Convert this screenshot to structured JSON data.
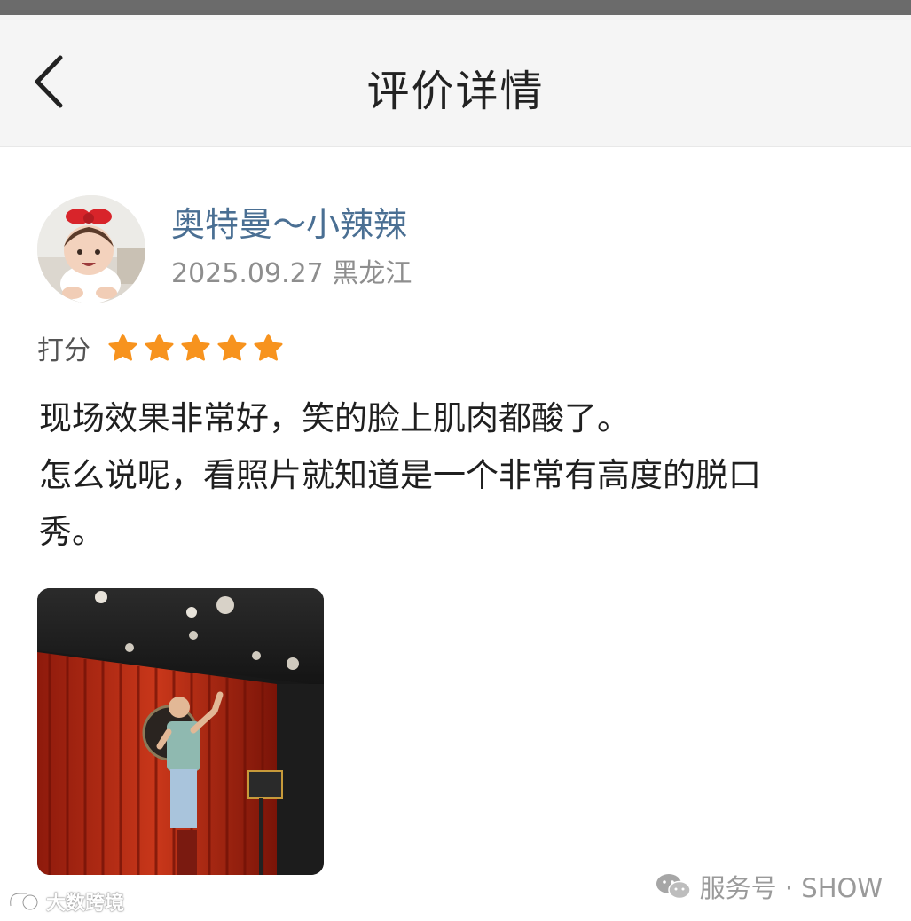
{
  "nav": {
    "title": "评价详情",
    "back_icon": "chevron-left-icon"
  },
  "review": {
    "user_name": "奥特曼～小辣辣",
    "date": "2025.09.27",
    "location": "黑龙江",
    "rating_label": "打分",
    "rating": 5,
    "rating_max": 5,
    "star_color": "#f7931e",
    "text_lines": [
      "现场效果非常好，笑的脸上肌肉都酸了。",
      "怎么说呢，看照片就知道是一个非常有高度的脱口",
      "秀。"
    ]
  },
  "watermarks": {
    "left": "大数跨境",
    "right": "服务号 · SHOW"
  },
  "colors": {
    "username": "#4a6f93",
    "meta": "#8e8e8e",
    "navbar": "#f5f5f5"
  }
}
